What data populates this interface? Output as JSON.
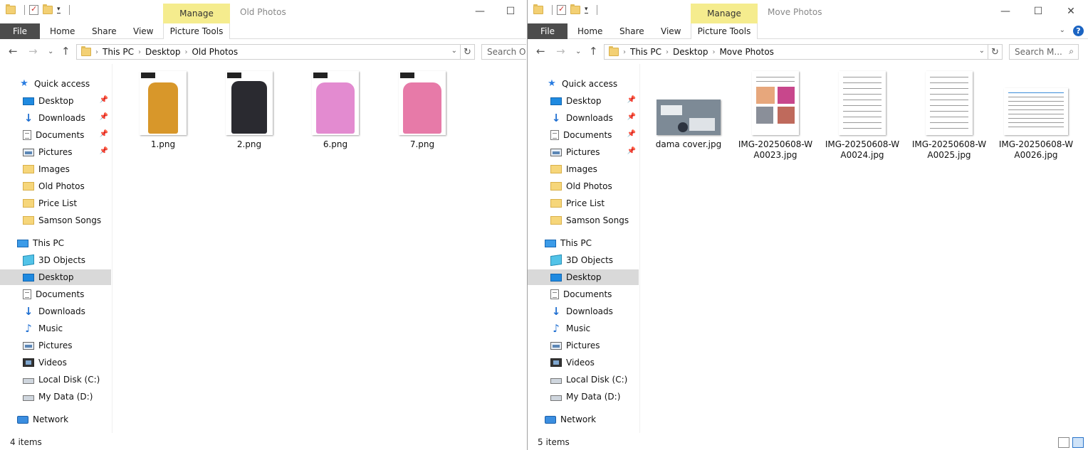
{
  "left": {
    "manage_label": "Manage",
    "window_title": "Old Photos",
    "ribbon_tabs": {
      "file": "File",
      "home": "Home",
      "share": "Share",
      "view": "View",
      "picture_tools": "Picture Tools"
    },
    "breadcrumb": [
      "This PC",
      "Desktop",
      "Old Photos"
    ],
    "search_placeholder": "Search Ol...",
    "quick_access": "Quick access",
    "pinned": [
      "Desktop",
      "Downloads",
      "Documents",
      "Pictures"
    ],
    "folders": [
      "Images",
      "Old Photos",
      "Price List",
      "Samson Songs"
    ],
    "this_pc": "This PC",
    "pc_items": [
      "3D Objects",
      "Desktop",
      "Documents",
      "Downloads",
      "Music",
      "Pictures",
      "Videos",
      "Local Disk (C:)",
      "My Data (D:)"
    ],
    "network": "Network",
    "files": [
      {
        "name": "1.png",
        "color": "#d8972a"
      },
      {
        "name": "2.png",
        "color": "#2a2a30"
      },
      {
        "name": "6.png",
        "color": "#e38bd0"
      },
      {
        "name": "7.png",
        "color": "#e77aa8"
      }
    ],
    "status": "4 items"
  },
  "right": {
    "manage_label": "Manage",
    "window_title": "Move Photos",
    "ribbon_tabs": {
      "file": "File",
      "home": "Home",
      "share": "Share",
      "view": "View",
      "picture_tools": "Picture Tools"
    },
    "breadcrumb": [
      "This PC",
      "Desktop",
      "Move Photos"
    ],
    "search_placeholder": "Search M...",
    "quick_access": "Quick access",
    "pinned": [
      "Desktop",
      "Downloads",
      "Documents",
      "Pictures"
    ],
    "folders": [
      "Images",
      "Old Photos",
      "Price List",
      "Samson Songs"
    ],
    "this_pc": "This PC",
    "pc_items": [
      "3D Objects",
      "Desktop",
      "Documents",
      "Downloads",
      "Music",
      "Pictures",
      "Videos",
      "Local Disk (C:)",
      "My Data (D:)"
    ],
    "network": "Network",
    "files": [
      {
        "name": "dama cover.jpg",
        "kind": "photo"
      },
      {
        "name": "IMG-20250608-WA0023.jpg",
        "kind": "flyer"
      },
      {
        "name": "IMG-20250608-WA0024.jpg",
        "kind": "doc"
      },
      {
        "name": "IMG-20250608-WA0025.jpg",
        "kind": "doc"
      },
      {
        "name": "IMG-20250608-WA0026.jpg",
        "kind": "docwide"
      }
    ],
    "status": "5 items"
  }
}
